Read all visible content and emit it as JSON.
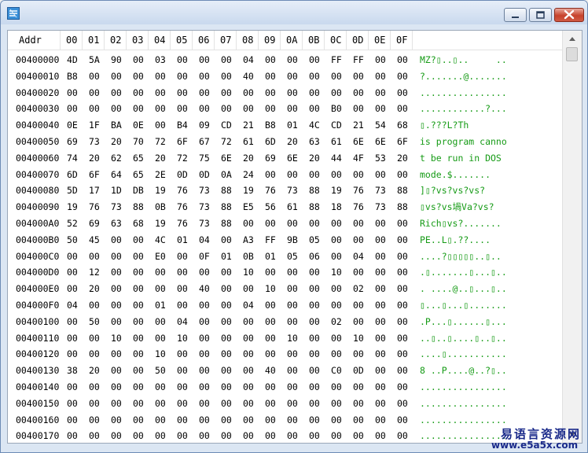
{
  "header": {
    "addr": "Addr",
    "cols": [
      "00",
      "01",
      "02",
      "03",
      "04",
      "05",
      "06",
      "07",
      "08",
      "09",
      "0A",
      "0B",
      "0C",
      "0D",
      "0E",
      "0F"
    ]
  },
  "rows": [
    {
      "addr": "00400000",
      "bytes": [
        "4D",
        "5A",
        "90",
        "00",
        "03",
        "00",
        "00",
        "00",
        "04",
        "00",
        "00",
        "00",
        "FF",
        "FF",
        "00",
        "00"
      ],
      "ascii": "MZ?▯..▯..     .."
    },
    {
      "addr": "00400010",
      "bytes": [
        "B8",
        "00",
        "00",
        "00",
        "00",
        "00",
        "00",
        "00",
        "40",
        "00",
        "00",
        "00",
        "00",
        "00",
        "00",
        "00"
      ],
      "ascii": "?.......@......."
    },
    {
      "addr": "00400020",
      "bytes": [
        "00",
        "00",
        "00",
        "00",
        "00",
        "00",
        "00",
        "00",
        "00",
        "00",
        "00",
        "00",
        "00",
        "00",
        "00",
        "00"
      ],
      "ascii": "................"
    },
    {
      "addr": "00400030",
      "bytes": [
        "00",
        "00",
        "00",
        "00",
        "00",
        "00",
        "00",
        "00",
        "00",
        "00",
        "00",
        "00",
        "B0",
        "00",
        "00",
        "00"
      ],
      "ascii": "............?..."
    },
    {
      "addr": "00400040",
      "bytes": [
        "0E",
        "1F",
        "BA",
        "0E",
        "00",
        "B4",
        "09",
        "CD",
        "21",
        "B8",
        "01",
        "4C",
        "CD",
        "21",
        "54",
        "68"
      ],
      "ascii": "▯.???L?Th"
    },
    {
      "addr": "00400050",
      "bytes": [
        "69",
        "73",
        "20",
        "70",
        "72",
        "6F",
        "67",
        "72",
        "61",
        "6D",
        "20",
        "63",
        "61",
        "6E",
        "6E",
        "6F"
      ],
      "ascii": "is program canno"
    },
    {
      "addr": "00400060",
      "bytes": [
        "74",
        "20",
        "62",
        "65",
        "20",
        "72",
        "75",
        "6E",
        "20",
        "69",
        "6E",
        "20",
        "44",
        "4F",
        "53",
        "20"
      ],
      "ascii": "t be run in DOS "
    },
    {
      "addr": "00400070",
      "bytes": [
        "6D",
        "6F",
        "64",
        "65",
        "2E",
        "0D",
        "0D",
        "0A",
        "24",
        "00",
        "00",
        "00",
        "00",
        "00",
        "00",
        "00"
      ],
      "ascii": "mode.$......."
    },
    {
      "addr": "00400080",
      "bytes": [
        "5D",
        "17",
        "1D",
        "DB",
        "19",
        "76",
        "73",
        "88",
        "19",
        "76",
        "73",
        "88",
        "19",
        "76",
        "73",
        "88"
      ],
      "ascii": "]▯?vs?vs?vs?"
    },
    {
      "addr": "00400090",
      "bytes": [
        "19",
        "76",
        "73",
        "88",
        "0B",
        "76",
        "73",
        "88",
        "E5",
        "56",
        "61",
        "88",
        "18",
        "76",
        "73",
        "88"
      ],
      "ascii": "▯vs?vs堝Va?vs?"
    },
    {
      "addr": "004000A0",
      "bytes": [
        "52",
        "69",
        "63",
        "68",
        "19",
        "76",
        "73",
        "88",
        "00",
        "00",
        "00",
        "00",
        "00",
        "00",
        "00",
        "00"
      ],
      "ascii": "Rich▯vs?......."
    },
    {
      "addr": "004000B0",
      "bytes": [
        "50",
        "45",
        "00",
        "00",
        "4C",
        "01",
        "04",
        "00",
        "A3",
        "FF",
        "9B",
        "05",
        "00",
        "00",
        "00",
        "00"
      ],
      "ascii": "PE..L▯.??...."
    },
    {
      "addr": "004000C0",
      "bytes": [
        "00",
        "00",
        "00",
        "00",
        "E0",
        "00",
        "0F",
        "01",
        "0B",
        "01",
        "05",
        "06",
        "00",
        "04",
        "00",
        "00"
      ],
      "ascii": "....?▯▯▯▯▯..▯.."
    },
    {
      "addr": "004000D0",
      "bytes": [
        "00",
        "12",
        "00",
        "00",
        "00",
        "00",
        "00",
        "00",
        "10",
        "00",
        "00",
        "00",
        "10",
        "00",
        "00",
        "00"
      ],
      "ascii": ".▯.......▯...▯.."
    },
    {
      "addr": "004000E0",
      "bytes": [
        "00",
        "20",
        "00",
        "00",
        "00",
        "00",
        "40",
        "00",
        "00",
        "10",
        "00",
        "00",
        "00",
        "02",
        "00",
        "00"
      ],
      "ascii": ". ....@..▯...▯.."
    },
    {
      "addr": "004000F0",
      "bytes": [
        "04",
        "00",
        "00",
        "00",
        "01",
        "00",
        "00",
        "00",
        "04",
        "00",
        "00",
        "00",
        "00",
        "00",
        "00",
        "00"
      ],
      "ascii": "▯...▯...▯......."
    },
    {
      "addr": "00400100",
      "bytes": [
        "00",
        "50",
        "00",
        "00",
        "00",
        "04",
        "00",
        "00",
        "00",
        "00",
        "00",
        "00",
        "02",
        "00",
        "00",
        "00"
      ],
      "ascii": ".P...▯......▯..."
    },
    {
      "addr": "00400110",
      "bytes": [
        "00",
        "00",
        "10",
        "00",
        "00",
        "10",
        "00",
        "00",
        "00",
        "00",
        "10",
        "00",
        "00",
        "10",
        "00",
        "00"
      ],
      "ascii": "..▯..▯....▯..▯.."
    },
    {
      "addr": "00400120",
      "bytes": [
        "00",
        "00",
        "00",
        "00",
        "10",
        "00",
        "00",
        "00",
        "00",
        "00",
        "00",
        "00",
        "00",
        "00",
        "00",
        "00"
      ],
      "ascii": "....▯..........."
    },
    {
      "addr": "00400130",
      "bytes": [
        "38",
        "20",
        "00",
        "00",
        "50",
        "00",
        "00",
        "00",
        "00",
        "40",
        "00",
        "00",
        "C0",
        "0D",
        "00",
        "00"
      ],
      "ascii": "8 ..P....@..?▯.."
    },
    {
      "addr": "00400140",
      "bytes": [
        "00",
        "00",
        "00",
        "00",
        "00",
        "00",
        "00",
        "00",
        "00",
        "00",
        "00",
        "00",
        "00",
        "00",
        "00",
        "00"
      ],
      "ascii": "................"
    },
    {
      "addr": "00400150",
      "bytes": [
        "00",
        "00",
        "00",
        "00",
        "00",
        "00",
        "00",
        "00",
        "00",
        "00",
        "00",
        "00",
        "00",
        "00",
        "00",
        "00"
      ],
      "ascii": "................"
    },
    {
      "addr": "00400160",
      "bytes": [
        "00",
        "00",
        "00",
        "00",
        "00",
        "00",
        "00",
        "00",
        "00",
        "00",
        "00",
        "00",
        "00",
        "00",
        "00",
        "00"
      ],
      "ascii": "................"
    },
    {
      "addr": "00400170",
      "bytes": [
        "00",
        "00",
        "00",
        "00",
        "00",
        "00",
        "00",
        "00",
        "00",
        "00",
        "00",
        "00",
        "00",
        "00",
        "00",
        "00"
      ],
      "ascii": "................"
    }
  ],
  "watermark": {
    "title": "易语言资源网",
    "url": "www.e5a5x.com"
  },
  "colors": {
    "ascii": "#169b16",
    "title_bar": "#c9d9ee",
    "close_button": "#c7432c"
  },
  "icons": {
    "app": "app-icon",
    "minimize": "minimize-icon",
    "maximize": "maximize-icon",
    "close": "close-icon",
    "scroll_up": "arrow-up-icon",
    "scroll_down": "arrow-down-icon"
  }
}
